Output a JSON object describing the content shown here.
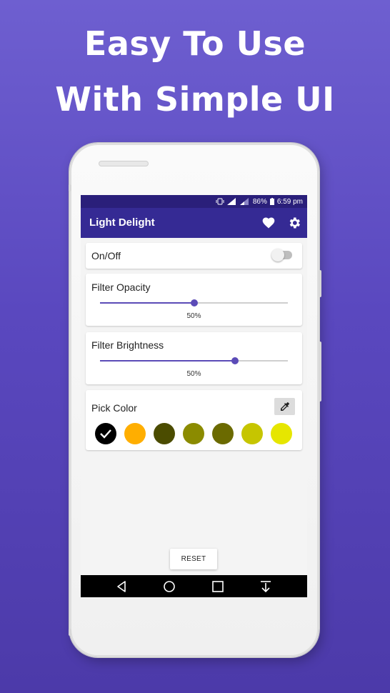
{
  "promo": {
    "line1": "Easy To Use",
    "line2": "With Simple UI"
  },
  "status_bar": {
    "battery": "86%",
    "time": "6:59 pm"
  },
  "app_bar": {
    "title": "Light Delight",
    "icons": [
      "heart-icon",
      "gear-icon"
    ]
  },
  "toggle_card": {
    "label": "On/Off",
    "checked": false
  },
  "opacity_card": {
    "label": "Filter Opacity",
    "value_label": "50%",
    "fill_fraction": 0.5
  },
  "brightness_card": {
    "label": "Filter Brightness",
    "value_label": "50%",
    "fill_fraction": 0.72
  },
  "color_card": {
    "label": "Pick Color",
    "picker_icon": "eyedropper-icon",
    "swatches": [
      {
        "color": "#000000",
        "selected": true
      },
      {
        "color": "#ffae00",
        "selected": false
      },
      {
        "color": "#4b4c00",
        "selected": false
      },
      {
        "color": "#8b8b00",
        "selected": false
      },
      {
        "color": "#6b6a00",
        "selected": false
      },
      {
        "color": "#c6c500",
        "selected": false
      },
      {
        "color": "#e6e600",
        "selected": false
      }
    ]
  },
  "reset_label": "RESET",
  "nav_bar": {
    "icons": [
      "back-icon",
      "home-icon",
      "recents-icon",
      "download-icon"
    ]
  },
  "colors": {
    "status_bar": "#2a1f7a",
    "app_bar": "#352a94",
    "accent": "#5b4bb7"
  }
}
